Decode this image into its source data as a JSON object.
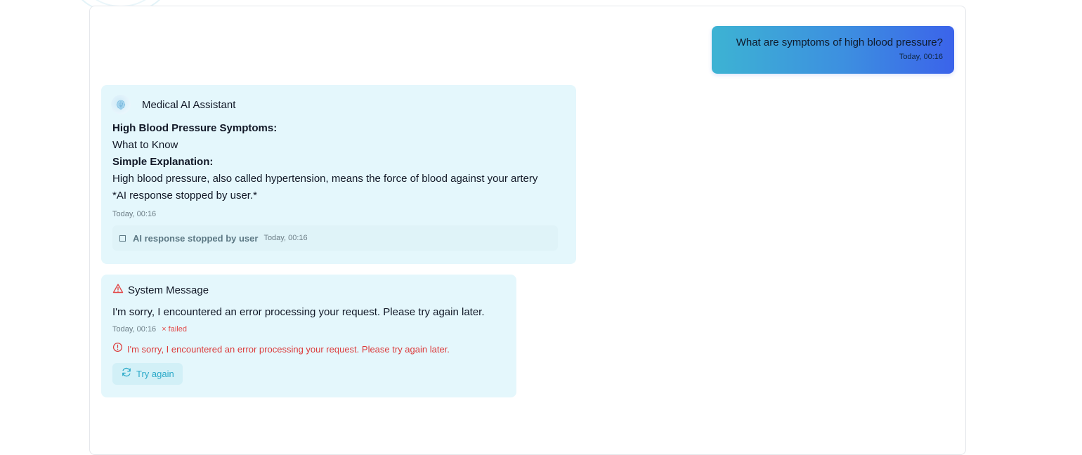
{
  "user_message": {
    "text": "What are symptoms of high blood pressure?",
    "time": "Today, 00:16"
  },
  "ai_message": {
    "sender": "Medical AI Assistant",
    "avatar_icon": "brain-icon",
    "lines": [
      {
        "text": "High Blood Pressure Symptoms:",
        "bold": true
      },
      {
        "text": "What to Know",
        "bold": false
      },
      {
        "text": "Simple Explanation:",
        "bold": true
      },
      {
        "text": "High blood pressure, also called hypertension, means the force of blood against your artery",
        "bold": false
      },
      {
        "text": "*AI response stopped by user.*",
        "bold": false
      }
    ],
    "time": "Today, 00:16",
    "stopped_notice": {
      "icon": "stop-square-icon",
      "label": "AI response stopped by user",
      "time": "Today, 00:16"
    }
  },
  "system_message": {
    "icon": "warning-triangle-icon",
    "title": "System Message",
    "text": "I'm sorry, I encountered an error processing your request. Please try again later.",
    "time": "Today, 00:16",
    "status": "× failed",
    "error_icon": "error-circle-icon",
    "error_text": "I'm sorry, I encountered an error processing your request. Please try again later.",
    "retry_icon": "refresh-icon",
    "retry_label": "Try again"
  },
  "colors": {
    "accent": "#2aa9c8",
    "bubble_bg": "#e4f7fc",
    "error": "#dc3b3b",
    "user_gradient_start": "#3db3d3",
    "user_gradient_end": "#3b63ea"
  }
}
